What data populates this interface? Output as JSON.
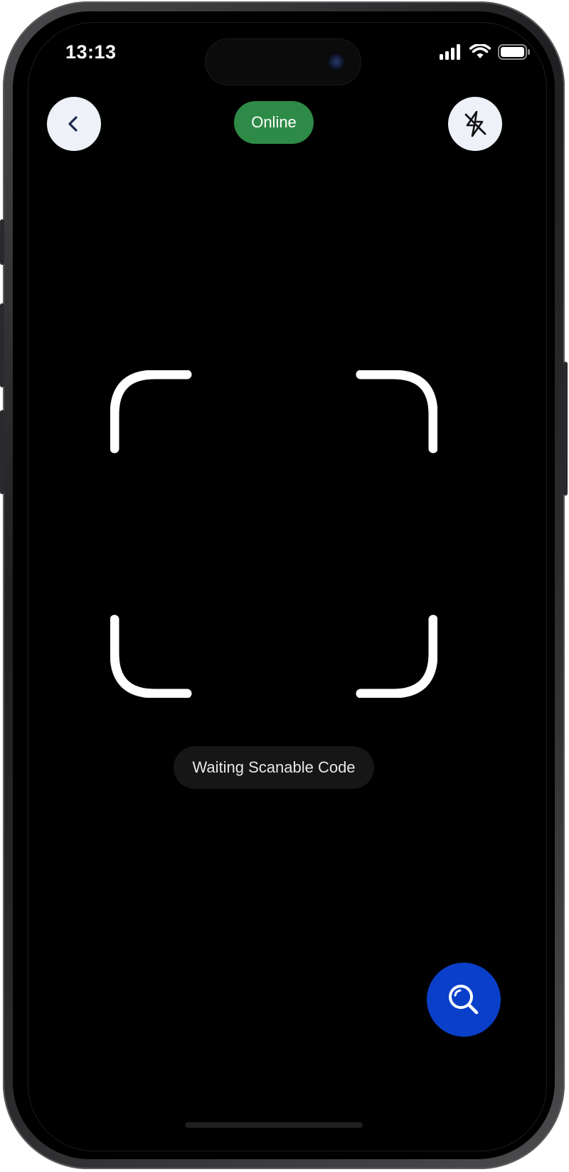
{
  "status_bar": {
    "time": "13:13",
    "icons": [
      "cellular-signal-icon",
      "wifi-icon",
      "battery-icon"
    ]
  },
  "header": {
    "back_icon": "chevron-left-icon",
    "status_label": "Online",
    "flash_icon": "flash-off-icon"
  },
  "scanner": {
    "frame_icon": "scan-frame-corners",
    "status_text": "Waiting Scanable Code"
  },
  "actions": {
    "search_icon": "search-icon"
  },
  "colors": {
    "background": "#000000",
    "online_green": "#2e8b47",
    "fab_blue": "#0a3fc9",
    "circle_button": "#eef1f8",
    "pill_dark": "#161617"
  }
}
